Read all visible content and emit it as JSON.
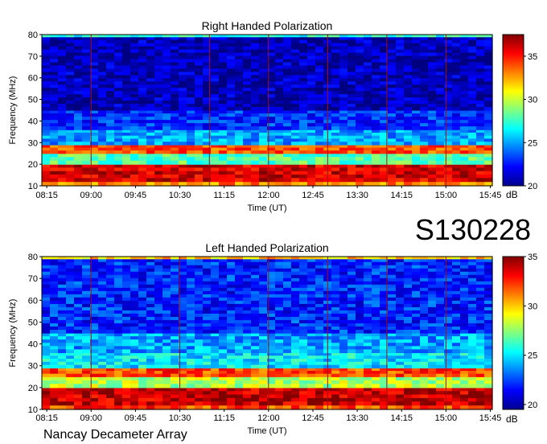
{
  "figure_id": "S130228",
  "footer": "Nancay Decameter Array",
  "chart_data": [
    {
      "type": "heatmap",
      "title": "Right Handed Polarization",
      "xlabel": "Time (UT)",
      "ylabel": "Frequency (MHz)",
      "x_ticks": [
        "08:15",
        "09:00",
        "09:45",
        "10:30",
        "11:15",
        "12:00",
        "12:45",
        "13:30",
        "14:15",
        "15:00",
        "15:45"
      ],
      "y_ticks": [
        10,
        20,
        30,
        40,
        50,
        60,
        70,
        80
      ],
      "ylim": [
        10,
        80
      ],
      "colorbar": {
        "label": "dB",
        "ticks": [
          20,
          25,
          30,
          35
        ],
        "range": [
          20,
          37.5
        ]
      },
      "bands": [
        {
          "fmin": 10,
          "fmax": 12,
          "level": 33
        },
        {
          "fmin": 12,
          "fmax": 20,
          "level": 36
        },
        {
          "fmin": 20,
          "fmax": 25,
          "level": 28
        },
        {
          "fmin": 25,
          "fmax": 29,
          "level": 34
        },
        {
          "fmin": 29,
          "fmax": 36,
          "level": 25
        },
        {
          "fmin": 36,
          "fmax": 45,
          "level": 23
        },
        {
          "fmin": 45,
          "fmax": 79,
          "level": 21
        },
        {
          "fmin": 79,
          "fmax": 80,
          "level": 27
        }
      ],
      "vertical_lines": [
        "09:00",
        "11:00",
        "12:00",
        "13:00",
        "14:00",
        "15:00"
      ]
    },
    {
      "type": "heatmap",
      "title": "Left Handed Polarization",
      "xlabel": "Time (UT)",
      "ylabel": "Frequency (MHz)",
      "x_ticks": [
        "08:15",
        "09:00",
        "09:45",
        "10:30",
        "11:15",
        "12:00",
        "12:45",
        "13:30",
        "14:15",
        "15:00",
        "15:45"
      ],
      "y_ticks": [
        10,
        20,
        30,
        40,
        50,
        60,
        70,
        80
      ],
      "ylim": [
        10,
        80
      ],
      "colorbar": {
        "label": "dB",
        "ticks": [
          20,
          25,
          30,
          35
        ],
        "range": [
          19.5,
          35
        ]
      },
      "bands": [
        {
          "fmin": 10,
          "fmax": 12,
          "level": 32
        },
        {
          "fmin": 12,
          "fmax": 20,
          "level": 34
        },
        {
          "fmin": 20,
          "fmax": 25,
          "level": 28
        },
        {
          "fmin": 25,
          "fmax": 29,
          "level": 32
        },
        {
          "fmin": 29,
          "fmax": 36,
          "level": 25
        },
        {
          "fmin": 36,
          "fmax": 45,
          "level": 24
        },
        {
          "fmin": 45,
          "fmax": 79,
          "level": 22
        },
        {
          "fmin": 79,
          "fmax": 80,
          "level": 30
        }
      ],
      "vertical_lines": [
        "09:00",
        "10:30",
        "12:00",
        "13:00",
        "14:00",
        "15:00"
      ]
    }
  ]
}
